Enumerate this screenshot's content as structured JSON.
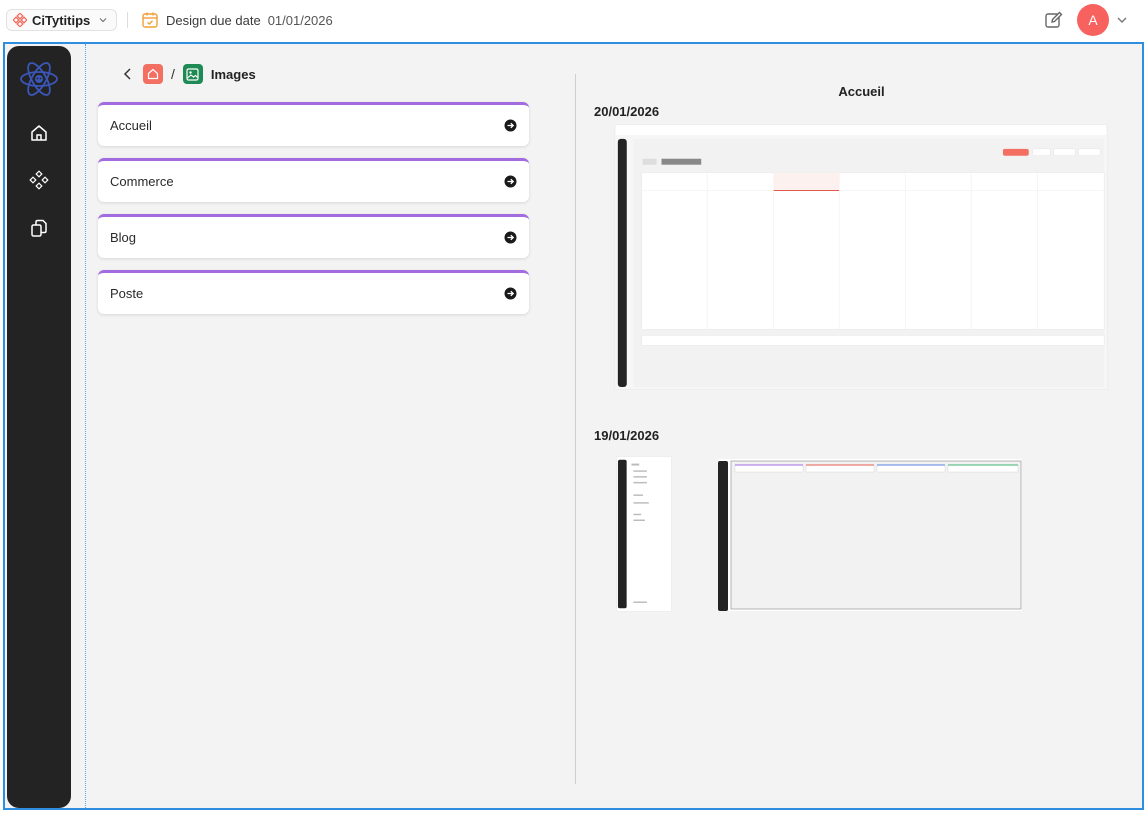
{
  "topbar": {
    "project_name": "CiTytitips",
    "due_label": "Design due date",
    "due_date": "01/01/2026",
    "avatar_initial": "A"
  },
  "breadcrumb": {
    "title": "Images",
    "separator": "/"
  },
  "pages": [
    {
      "label": "Accueil"
    },
    {
      "label": "Commerce"
    },
    {
      "label": "Blog"
    },
    {
      "label": "Poste"
    }
  ],
  "preview": {
    "title": "Accueil",
    "groups": [
      {
        "date": "20/01/2026"
      },
      {
        "date": "19/01/2026"
      }
    ]
  },
  "colors": {
    "accent_purple": "#a36be0",
    "avatar": "#f7625e",
    "frame_blue": "#2f8ee0",
    "rail": "#232323",
    "home_icon_bg": "#f26f62",
    "image_icon_bg": "#1e8a54",
    "calendar_icon": "#f0a03a"
  },
  "icons": {
    "project": "grid-dots-icon",
    "due": "calendar-check-icon",
    "edit": "edit-icon",
    "rail": [
      "home-icon",
      "components-icon",
      "pages-icon"
    ],
    "card_action": "arrow-right-circle-icon"
  }
}
